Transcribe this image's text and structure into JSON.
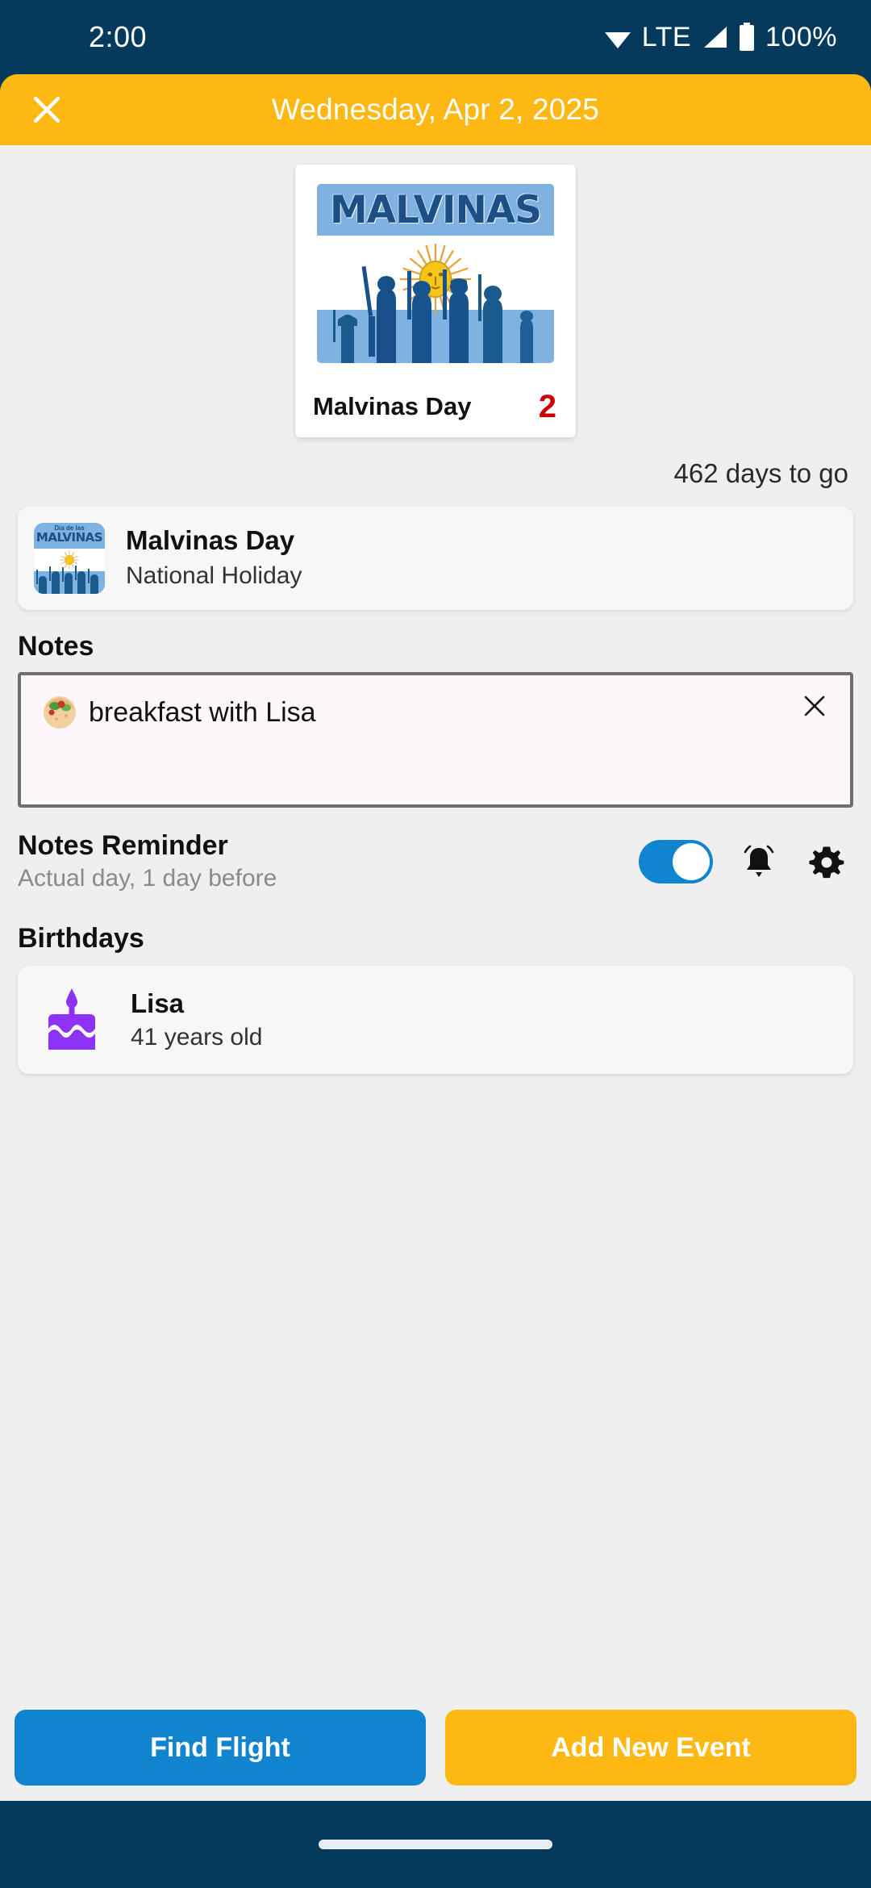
{
  "status_bar": {
    "clock": "2:00",
    "network": "LTE",
    "battery": "100%",
    "icons": [
      "wifi-icon",
      "signal-icon",
      "battery-icon"
    ]
  },
  "app_bar": {
    "close_icon": "close-icon",
    "title": "Wednesday, Apr 2, 2025",
    "bg_color": "#FDB813"
  },
  "hero": {
    "image_banner_word": "MALVINAS",
    "name": "Malvinas Day",
    "day_number": "2",
    "day_number_color": "#CC0000"
  },
  "countdown": "462 days to go",
  "holiday": {
    "thumb_small_text": "Dia de las",
    "thumb_word": "MALVINAS",
    "title": "Malvinas Day",
    "subtitle": "National Holiday"
  },
  "notes": {
    "heading": "Notes",
    "emoji_icon": "food-icon",
    "text": "breakfast with Lisa",
    "clear_icon": "close-icon"
  },
  "reminder": {
    "title": "Notes Reminder",
    "subtitle": "Actual day, 1 day before",
    "toggle_on": true,
    "toggle_color": "#1184D0",
    "bell_icon": "bell-icon",
    "settings_icon": "gear-icon"
  },
  "birthdays": {
    "heading": "Birthdays",
    "items": [
      {
        "icon": "cake-icon",
        "name": "Lisa",
        "age": "41 years old"
      }
    ]
  },
  "footer": {
    "find_flight_label": "Find Flight",
    "add_event_label": "Add New Event",
    "primary_color": "#1184D0",
    "accent_color": "#FDB813"
  }
}
